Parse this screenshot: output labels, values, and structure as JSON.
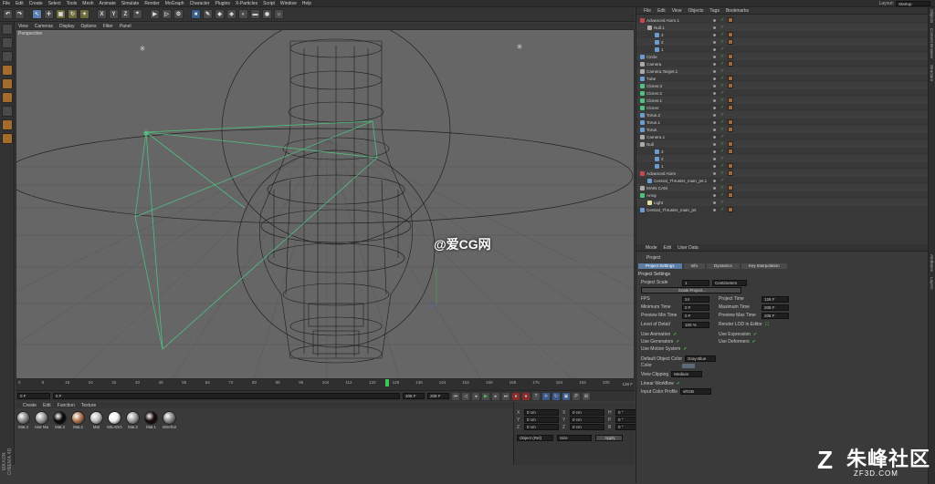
{
  "menubar": {
    "items": [
      "File",
      "Edit",
      "Create",
      "Select",
      "Tools",
      "Mesh",
      "Animate",
      "Simulate",
      "Render",
      "MoGraph",
      "Character",
      "Plugins",
      "X-Particles",
      "Script",
      "Window",
      "Help"
    ],
    "layout_label": "Layout:",
    "layout_value": "Startup"
  },
  "toolbar": {
    "axis_buttons": [
      "X",
      "Y",
      "Z"
    ]
  },
  "viewport": {
    "menu": [
      "View",
      "Cameras",
      "Display",
      "Options",
      "Filter",
      "Panel"
    ],
    "label": "Perspective"
  },
  "watermark": {
    "text": "@爱CG网"
  },
  "timeline": {
    "ticks": [
      "0",
      "8",
      "16",
      "24",
      "32",
      "40",
      "48",
      "56",
      "64",
      "72",
      "80",
      "88",
      "96",
      "104",
      "112",
      "120",
      "128",
      "136",
      "144",
      "152",
      "160",
      "168",
      "176",
      "184",
      "192",
      "200"
    ],
    "end_label": "126 F",
    "current_frame": 126
  },
  "transport": {
    "start": "0 F",
    "start2": "0 F",
    "end": "208 F",
    "end2": "208 F"
  },
  "materials": {
    "menu": [
      "Create",
      "Edit",
      "Function",
      "Texture"
    ],
    "items": [
      {
        "name": "Mat.4",
        "color": "#8a8a8a"
      },
      {
        "name": "Hair Ma",
        "color": "#9a9a9a"
      },
      {
        "name": "Mat.3",
        "color": "#0a0a0a"
      },
      {
        "name": "Mat.2",
        "color": "#b07a52"
      },
      {
        "name": "Mat",
        "color": "#c0c0c0"
      },
      {
        "name": "MILANO",
        "color": "#f0f0f0"
      },
      {
        "name": "Mat.2",
        "color": "#a0a0a0"
      },
      {
        "name": "Mat.1",
        "color": "#1a0a0a"
      },
      {
        "name": "Wirefrar",
        "color": "#8a8a8a"
      }
    ]
  },
  "coords": {
    "rows": [
      {
        "a": "X",
        "av": "0 cm",
        "b": "X",
        "bv": "0 cm",
        "c": "H",
        "cv": "0 °"
      },
      {
        "a": "Y",
        "av": "0 cm",
        "b": "Y",
        "bv": "0 cm",
        "c": "P",
        "cv": "0 °"
      },
      {
        "a": "Z",
        "av": "0 cm",
        "b": "Z",
        "bv": "0 cm",
        "c": "B",
        "cv": "0 °"
      }
    ],
    "mode": "Object (Rel)",
    "size": "Size",
    "apply": "Apply"
  },
  "object_manager": {
    "menu": [
      "File",
      "Edit",
      "View",
      "Objects",
      "Tags",
      "Bookmarks"
    ],
    "objects": [
      "Advanced Atom.1",
      "Null.1",
      "3",
      "2",
      "1",
      "Circle",
      "Camera",
      "Camera.Target.1",
      "Tube",
      "Cloner.3",
      "Cloner.2",
      "Cloner.1",
      "Cloner",
      "Torus.2",
      "Torus.1",
      "Torus",
      "Camera.1",
      "Null",
      "3",
      "2",
      "1",
      "Advanced Atom",
      "Central_Thruster_main_jet.1",
      "MAIN CAM",
      "Array",
      "Light",
      "Central_Thruster_main_jet"
    ]
  },
  "attribute_manager": {
    "menu": [
      "Mode",
      "Edit",
      "User Data"
    ],
    "project": "Project",
    "tabs": [
      "Project Settings",
      "Info",
      "Dynamics",
      "Key Interpolation"
    ],
    "section": "Project Settings",
    "project_scale_label": "Project Scale",
    "project_scale": "1",
    "units": "Centimeters",
    "scale_button": "Scale Project...",
    "fps_label": "FPS",
    "fps": "24",
    "project_time_label": "Project Time",
    "project_time": "126 F",
    "min_time_label": "Minimum Time",
    "min_time": "0 F",
    "max_time_label": "Maximum Time",
    "max_time": "208 F",
    "prev_min_label": "Preview Min Time",
    "prev_min": "0 F",
    "prev_max_label": "Preview Max Time",
    "prev_max": "208 F",
    "lod_label": "Level of Detail",
    "lod": "100 %",
    "render_lod_label": "Render LOD in Editor",
    "use_animation": "Use Animation",
    "use_expression": "Use Expression",
    "use_generators": "Use Generators",
    "use_deformers": "Use Deformers",
    "use_motion": "Use Motion System",
    "default_color_label": "Default Object Color",
    "default_color": "Gray-Blue",
    "color_label": "Color",
    "view_clipping_label": "View Clipping",
    "view_clipping": "Medium",
    "linear_label": "Linear Workflow",
    "input_profile_label": "Input Color Profile",
    "input_profile": "sRGB"
  },
  "logo": {
    "big": "朱峰社区",
    "small": "ZF3D.COM"
  },
  "cinema_logo": "MAXON CINEMA 4D",
  "right_tabs": [
    "Objects",
    "Content Browser",
    "Structure",
    "Attributes",
    "Layers"
  ]
}
